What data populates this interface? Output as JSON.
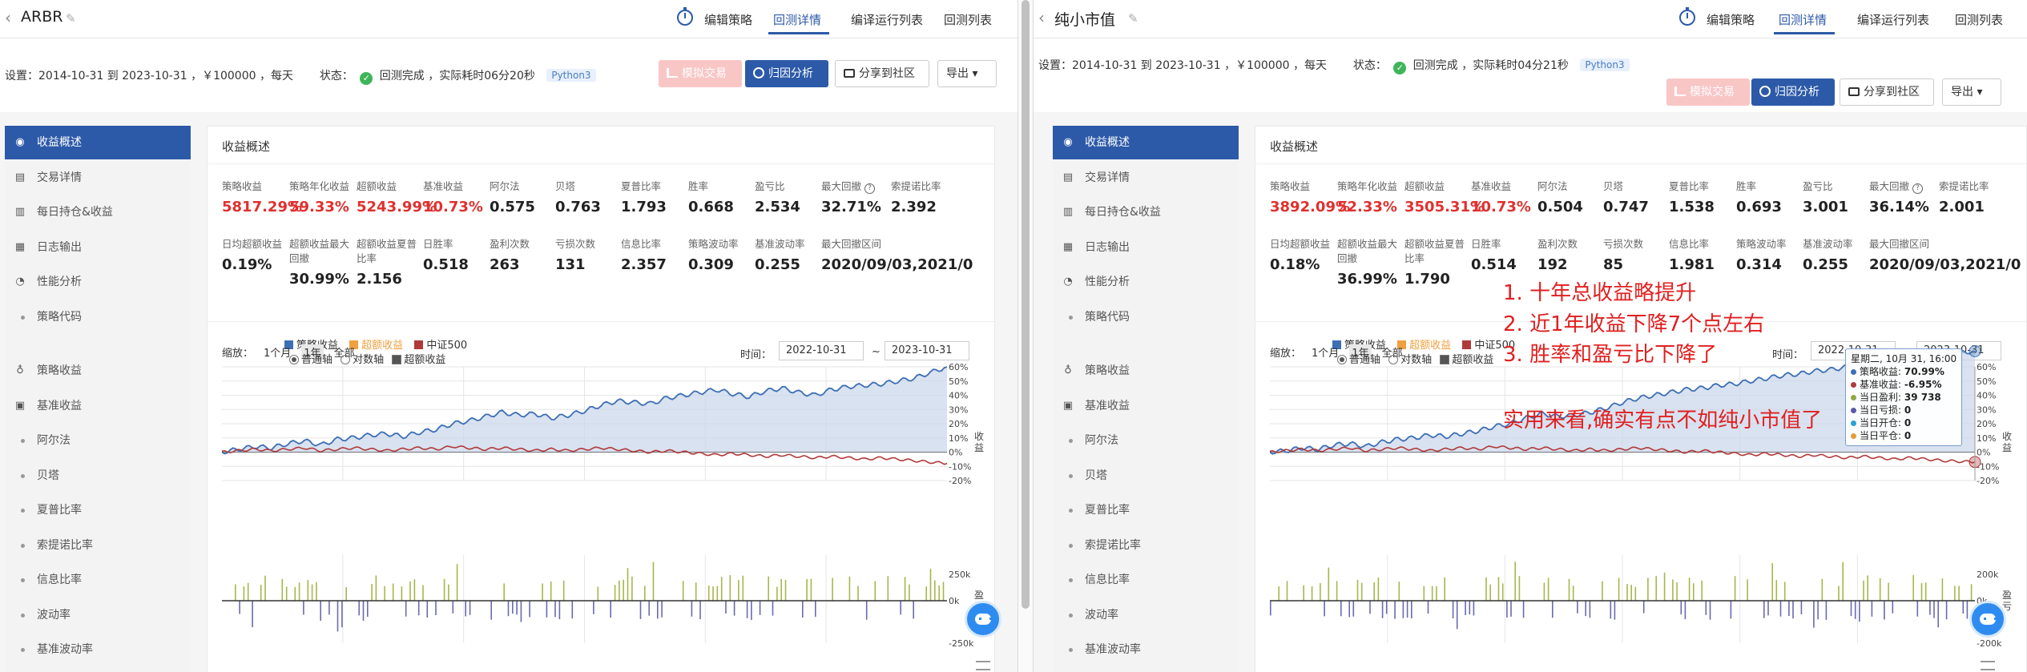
{
  "nav": {
    "edit": "编辑策略",
    "backtest": "回测详情",
    "compile": "编译运行列表",
    "backtest_list": "回测列表"
  },
  "buttons": {
    "simulate": "模拟交易",
    "attribution": "归因分析",
    "share": "分享到社区",
    "export": "导出"
  },
  "sidebar": [
    {
      "label": "收益概述",
      "icon": "chart-icon",
      "active": true
    },
    {
      "label": "交易详情",
      "icon": "doc-icon"
    },
    {
      "label": "每日持仓&收益",
      "icon": "bar-icon"
    },
    {
      "label": "日志输出",
      "icon": "log-icon"
    },
    {
      "label": "性能分析",
      "icon": "pie-icon"
    },
    {
      "label": "策略代码",
      "sub": true
    },
    {
      "label": "策略收益",
      "icon": "bulb-icon"
    },
    {
      "label": "基准收益",
      "icon": "db-icon"
    },
    {
      "label": "阿尔法",
      "sub": true
    },
    {
      "label": "贝塔",
      "sub": true
    },
    {
      "label": "夏普比率",
      "sub": true
    },
    {
      "label": "索提诺比率",
      "sub": true
    },
    {
      "label": "信息比率",
      "sub": true
    },
    {
      "label": "波动率",
      "sub": true
    },
    {
      "label": "基准波动率",
      "sub": true
    }
  ],
  "section_title": "收益概述",
  "chart_ui": {
    "zoom_label": "缩放：",
    "zoom_1m": "1个月",
    "zoom_1y": "1年",
    "zoom_all": "全部",
    "legend_strategy": "策略收益",
    "legend_excess": "超额收益",
    "legend_benchmark": "中证500",
    "axis_normal": "普通轴",
    "axis_log": "对数轴",
    "check_excess": "超额收益",
    "time_label": "时间：",
    "date_from": "2022-10-31",
    "date_to": "2023-10-31",
    "dash": "~",
    "y_label": "收益",
    "y2_label": "盈亏"
  },
  "metric_labels_row1": [
    "策略收益",
    "策略年化收益",
    "超额收益",
    "基准收益",
    "阿尔法",
    "贝塔",
    "夏普比率",
    "胜率",
    "盈亏比",
    "最大回撤",
    "索提诺比率"
  ],
  "metric_labels_row2": [
    "日均超额收益",
    "超额收益最大回撤",
    "超额收益夏普比率",
    "日胜率",
    "盈利次数",
    "亏损次数",
    "信息比率",
    "策略波动率",
    "基准波动率",
    "最大回撤区间"
  ],
  "left": {
    "name": "ARBR",
    "settings": "设置：2014-10-31 到 2023-10-31 ，￥100000 ，每天",
    "status_label": "状态：",
    "status": "回测完成 ，实际耗时06分20秒",
    "lang": "Python3",
    "row1_values": [
      "5817.29%",
      "59.33%",
      "5243.99%",
      "10.73%",
      "0.575",
      "0.763",
      "1.793",
      "0.668",
      "2.534",
      "32.71%",
      "2.392"
    ],
    "row2_values": [
      "0.19%",
      "30.99%",
      "2.156",
      "0.518",
      "263",
      "131",
      "2.357",
      "0.309",
      "0.255",
      "2020/09/03,2021/0"
    ],
    "y_ticks": [
      "60%",
      "50%",
      "40%",
      "30%",
      "20%",
      "10%",
      "0%",
      "-10%",
      "-20%"
    ],
    "y2_ticks": [
      "250k",
      "0k",
      "-250k"
    ]
  },
  "right": {
    "name": "纯小市值",
    "settings": "设置：2014-10-31 到 2023-10-31 ，￥100000 ，每天",
    "status_label": "状态：",
    "status": "回测完成 ，实际耗时04分21秒",
    "lang": "Python3",
    "row1_values": [
      "3892.09%",
      "52.33%",
      "3505.31%",
      "10.73%",
      "0.504",
      "0.747",
      "1.538",
      "0.693",
      "3.001",
      "36.14%",
      "2.001"
    ],
    "row2_values": [
      "0.18%",
      "36.99%",
      "1.790",
      "0.514",
      "192",
      "85",
      "1.981",
      "0.314",
      "0.255",
      "2020/09/03,2021/0"
    ],
    "y_ticks": [
      "60%",
      "50%",
      "40%",
      "30%",
      "20%",
      "10%",
      "0%",
      "-10%",
      "-20%"
    ],
    "y2_ticks": [
      "200k",
      "0k",
      "-200k"
    ],
    "tooltip": {
      "date": "星期二, 10月 31, 16:00",
      "rows": [
        {
          "label": "策略收益: ",
          "value": "70.99%",
          "color": "#3d6fb5"
        },
        {
          "label": "基准收益: ",
          "value": "-6.95%",
          "color": "#b03a3a"
        },
        {
          "label": "当日盈利: ",
          "value": "39 738",
          "color": "#8fa846"
        },
        {
          "label": "当日亏损: ",
          "value": "0",
          "color": "#5a5aa8"
        },
        {
          "label": "当日开仓: ",
          "value": "0",
          "color": "#2aa0d8"
        },
        {
          "label": "当日平仓: ",
          "value": "0",
          "color": "#e59b3a"
        }
      ]
    },
    "annotations": [
      "1. 十年总收益略提升",
      "2. 近1年收益下降7个点左右",
      "3. 胜率和盈亏比下降了",
      "实用来看,确实有点不如纯小市值了"
    ]
  },
  "chart_data": [
    {
      "type": "line",
      "title": "",
      "xlabel": "",
      "ylabel": "收益",
      "x_range": [
        "2022-10-31",
        "2023-10-31"
      ],
      "ylim": [
        -20,
        60
      ],
      "series": [
        {
          "name": "策略收益",
          "values": [
            0,
            2,
            4,
            3,
            6,
            8,
            5,
            9,
            10,
            12,
            13,
            11,
            14,
            16,
            20,
            22,
            25,
            28,
            26,
            27,
            24,
            26,
            29,
            33,
            36,
            35,
            34,
            38,
            40,
            42,
            44,
            41,
            39,
            43,
            45,
            42,
            40,
            44,
            46,
            47,
            48,
            50,
            52,
            56,
            60
          ]
        },
        {
          "name": "中证500",
          "values": [
            0,
            1,
            2,
            1,
            2,
            3,
            1,
            2,
            3,
            2,
            1,
            2,
            3,
            2,
            4,
            3,
            2,
            3,
            2,
            1,
            2,
            1,
            2,
            3,
            2,
            1,
            0,
            1,
            0,
            -1,
            -2,
            -1,
            -2,
            -3,
            -2,
            -3,
            -4,
            -3,
            -4,
            -5,
            -4,
            -5,
            -6,
            -7,
            -8
          ]
        }
      ]
    },
    {
      "type": "line",
      "title": "",
      "xlabel": "",
      "ylabel": "收益",
      "x_range": [
        "2022-10-31",
        "2023-10-31"
      ],
      "ylim": [
        -20,
        60
      ],
      "series": [
        {
          "name": "策略收益",
          "values": [
            0,
            1,
            3,
            2,
            5,
            6,
            4,
            7,
            9,
            10,
            12,
            11,
            13,
            15,
            18,
            20,
            24,
            27,
            25,
            26,
            28,
            31,
            35,
            38,
            40,
            42,
            44,
            45,
            47,
            48,
            50,
            52,
            54,
            55,
            57,
            58,
            60,
            61,
            63,
            64,
            65,
            66,
            68,
            70,
            70.99
          ]
        },
        {
          "name": "中证500",
          "values": [
            0,
            1,
            2,
            1,
            2,
            3,
            1,
            2,
            3,
            2,
            1,
            2,
            3,
            2,
            4,
            3,
            2,
            3,
            2,
            1,
            2,
            1,
            2,
            3,
            2,
            1,
            0,
            1,
            0,
            -1,
            -2,
            -1,
            -2,
            -3,
            -2,
            -3,
            -4,
            -3,
            -4,
            -5,
            -4,
            -5,
            -6,
            -6.5,
            -6.95
          ]
        }
      ]
    }
  ]
}
